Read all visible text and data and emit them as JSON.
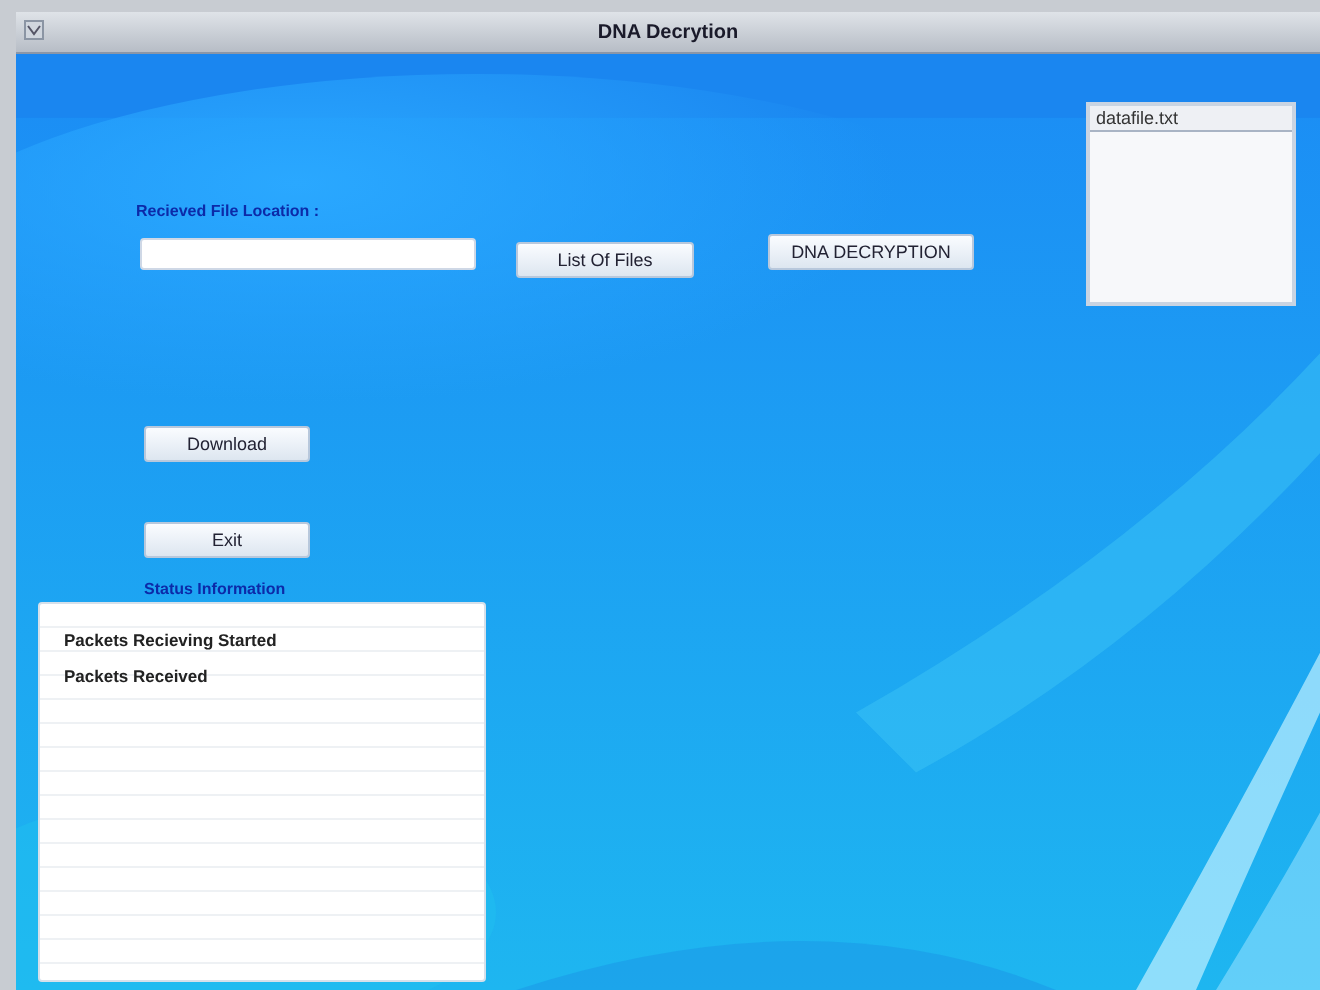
{
  "window": {
    "title": "DNA Decrytion"
  },
  "file_location": {
    "label": "Recieved File Location :"
  },
  "buttons": [
    {
      "kind": "list",
      "label": "List Of Files"
    },
    {
      "kind": "decrypt",
      "label": "DNA DECRYPTION"
    },
    {
      "kind": "download",
      "label": "Download"
    },
    {
      "kind": "exit",
      "label": "Exit"
    }
  ],
  "file_list": {
    "items": [
      {
        "name": "datafile.txt",
        "selected": true
      }
    ]
  },
  "status": {
    "label": "Status Information",
    "lines": [
      "Packets Recieving Started",
      "Packets Received"
    ]
  }
}
